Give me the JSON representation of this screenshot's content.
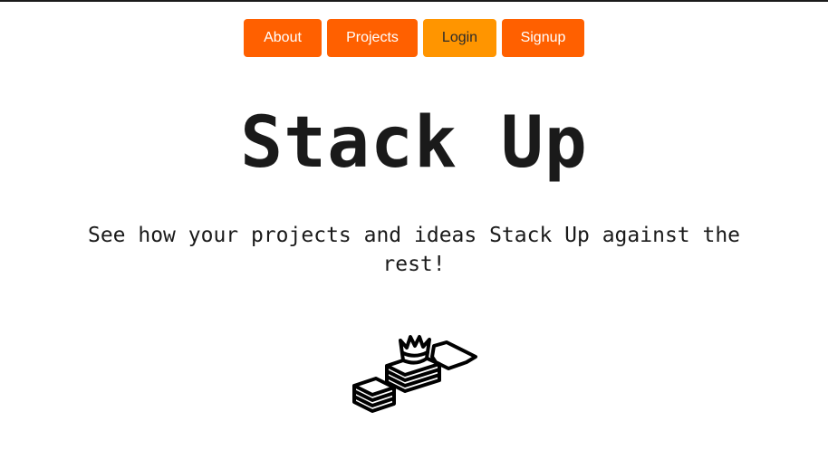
{
  "colors": {
    "nav_primary": "#ff6000",
    "nav_active": "#ff9500",
    "nav_primary_text": "#ffffff",
    "nav_active_text": "#2b2b2b"
  },
  "nav": {
    "items": [
      {
        "label": "About"
      },
      {
        "label": "Projects"
      },
      {
        "label": "Login"
      },
      {
        "label": "Signup"
      }
    ]
  },
  "hero": {
    "title": "Stack Up",
    "subtitle": "See how your projects and ideas Stack Up against the rest!"
  },
  "logo": {
    "icon": "stacked-blocks-crown-icon"
  }
}
